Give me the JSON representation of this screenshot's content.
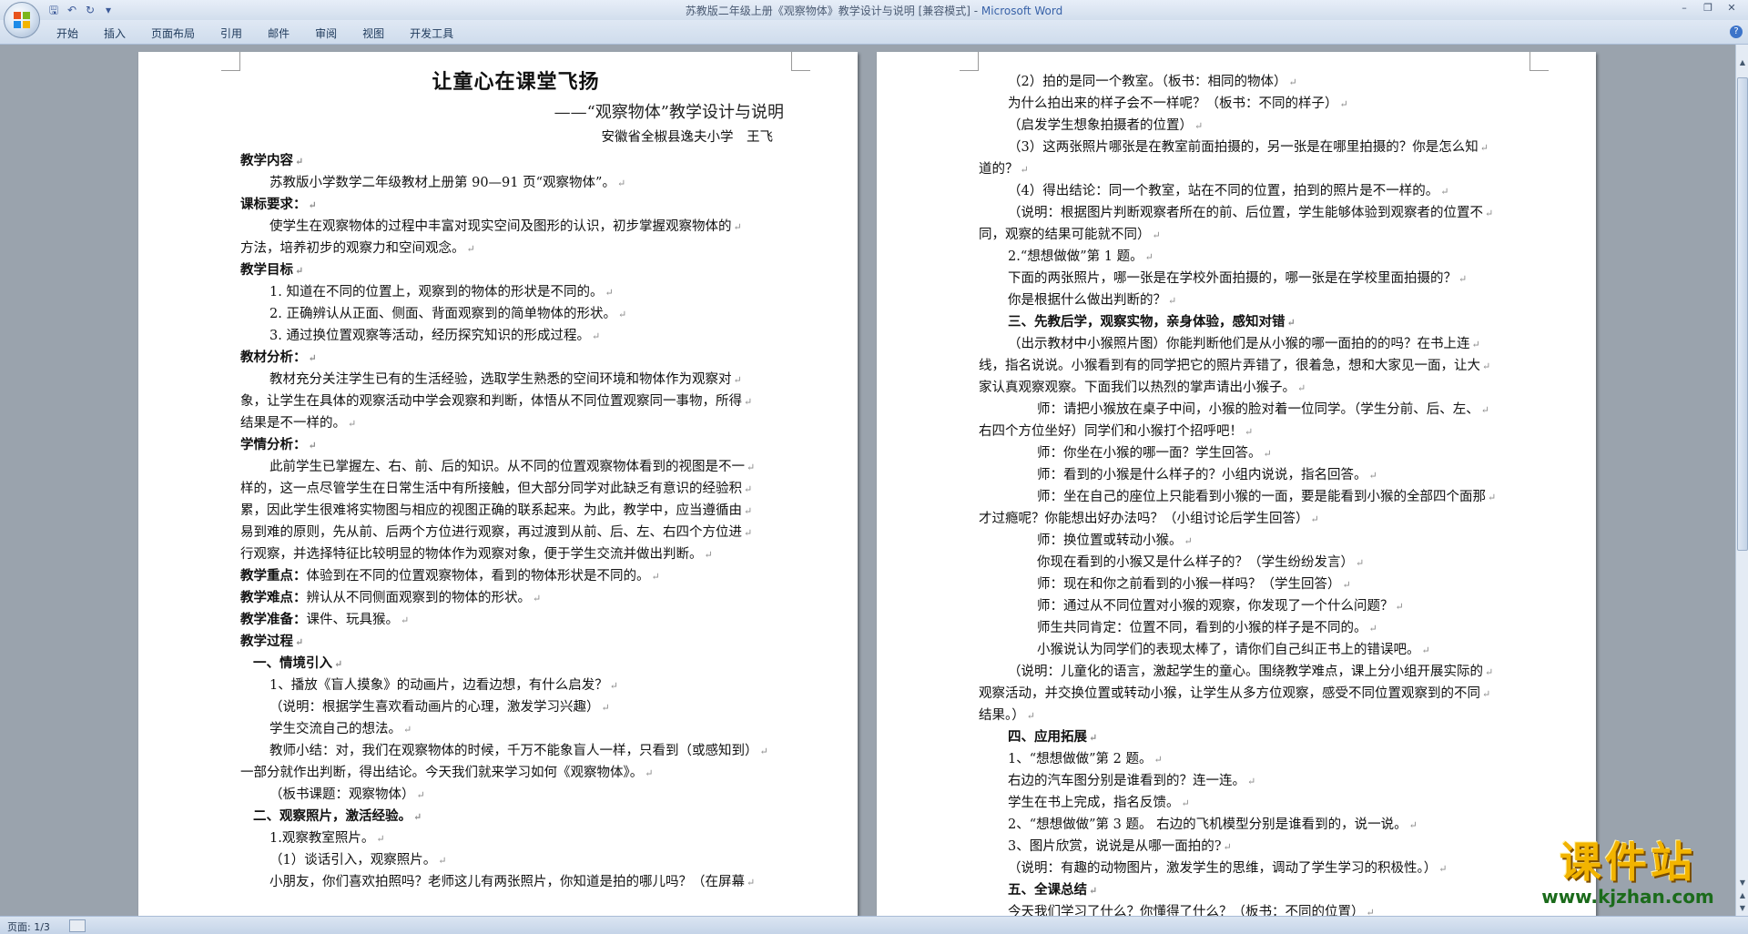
{
  "window": {
    "title": "苏教版二年级上册《观察物体》教学设计与说明 [兼容模式] - ",
    "app_name": "Microsoft Word"
  },
  "ribbon": {
    "tabs": [
      "开始",
      "插入",
      "页面布局",
      "引用",
      "邮件",
      "审阅",
      "视图",
      "开发工具"
    ]
  },
  "status": {
    "page": "页面: 1/3"
  },
  "watermark": {
    "title": "课件站",
    "url": "www.kjzhan.com"
  },
  "page_left": {
    "title": "让童心在课堂飞扬",
    "subtitle": "——“观察物体”教学设计与说明",
    "author": "安徽省全椒县逸夫小学　王飞",
    "lines": [
      {
        "t": "教学内容",
        "c": "b"
      },
      {
        "t": "苏教版小学数学二年级教材上册第 90—91 页“观察物体”。",
        "c": "i1"
      },
      {
        "t": "课标要求：",
        "c": "b"
      },
      {
        "t": "使学生在观察物体的过程中丰富对现实空间及图形的认识，初步掌握观察物体的",
        "c": "i1"
      },
      {
        "t": "方法，培养初步的观察力和空间观念。",
        "c": ""
      },
      {
        "t": "教学目标",
        "c": "b"
      },
      {
        "t": "1. 知道在不同的位置上，观察到的物体的形状是不同的。",
        "c": "i1"
      },
      {
        "t": "2. 正确辨认从正面、侧面、背面观察到的简单物体的形状。",
        "c": "i1"
      },
      {
        "t": "3. 通过换位置观察等活动，经历探究知识的形成过程。",
        "c": "i1"
      },
      {
        "t": "教材分析：",
        "c": "b"
      },
      {
        "t": "教材充分关注学生已有的生活经验，选取学生熟悉的空间环境和物体作为观察对",
        "c": "i1"
      },
      {
        "t": "象，让学生在具体的观察活动中学会观察和判断，体悟从不同位置观察同一事物，所得",
        "c": ""
      },
      {
        "t": "结果是不一样的。",
        "c": ""
      },
      {
        "t": "学情分析：",
        "c": "b"
      },
      {
        "t": "此前学生已掌握左、右、前、后的知识。从不同的位置观察物体看到的视图是不一",
        "c": "i1"
      },
      {
        "t": "样的，这一点尽管学生在日常生活中有所接触，但大部分同学对此缺乏有意识的经验积",
        "c": ""
      },
      {
        "t": "累，因此学生很难将实物图与相应的视图正确的联系起来。为此，教学中，应当遵循由",
        "c": ""
      },
      {
        "t": "易到难的原则，先从前、后两个方位进行观察，再过渡到从前、后、左、右四个方位进",
        "c": ""
      },
      {
        "t": "行观察，并选择特征比较明显的物体作为观察对象，便于学生交流并做出判断。",
        "c": ""
      },
      {
        "t": "教学重点：体验到在不同的位置观察物体，看到的物体形状是不同的。",
        "c": "bl"
      },
      {
        "t": "教学难点：辨认从不同侧面观察到的物体的形状。",
        "c": "bl"
      },
      {
        "t": "教学准备：课件、玩具猴。",
        "c": "bl"
      },
      {
        "t": "教学过程",
        "c": "b"
      },
      {
        "t": "一、情境引入",
        "c": "b i0"
      },
      {
        "t": "1、播放《盲人摸象》的动画片，边看边想，有什么启发？",
        "c": "i1"
      },
      {
        "t": "（说明：根据学生喜欢看动画片的心理，激发学习兴趣）",
        "c": "i1"
      },
      {
        "t": "学生交流自己的想法。",
        "c": "i1"
      },
      {
        "t": "教师小结：对，我们在观察物体的时候，千万不能象盲人一样，只看到（或感知到）",
        "c": "i1"
      },
      {
        "t": "一部分就作出判断，得出结论。今天我们就来学习如何《观察物体》。",
        "c": ""
      },
      {
        "t": "（板书课题：观察物体）",
        "c": "i1"
      },
      {
        "t": "二、观察照片，激活经验。",
        "c": "b i0"
      },
      {
        "t": "1.观察教室照片。",
        "c": "i1"
      },
      {
        "t": "（1）谈话引入，观察照片。",
        "c": "i1"
      },
      {
        "t": "小朋友，你们喜欢拍照吗？老师这儿有两张照片，你知道是拍的哪儿吗？（在屏幕",
        "c": "i1"
      }
    ]
  },
  "page_right": {
    "lines": [
      {
        "t": "（2）拍的是同一个教室。（板书：相同的物体）",
        "c": "i1"
      },
      {
        "t": "为什么拍出来的样子会不一样呢？（板书：不同的样子）",
        "c": "i1"
      },
      {
        "t": "（启发学生想象拍摄者的位置）",
        "c": "i1"
      },
      {
        "t": "（3）这两张照片哪张是在教室前面拍摄的，另一张是在哪里拍摄的？你是怎么知",
        "c": "i1"
      },
      {
        "t": "道的？",
        "c": ""
      },
      {
        "t": "（4）得出结论：同一个教室，站在不同的位置，拍到的照片是不一样的。",
        "c": "i1"
      },
      {
        "t": "（说明：根据图片判断观察者所在的前、后位置，学生能够体验到观察者的位置不",
        "c": "i1"
      },
      {
        "t": "同，观察的结果可能就不同）",
        "c": ""
      },
      {
        "t": "2.“想想做做”第 1 题。",
        "c": "i1"
      },
      {
        "t": "下面的两张照片，哪一张是在学校外面拍摄的，哪一张是在学校里面拍摄的？",
        "c": "i1"
      },
      {
        "t": "你是根据什么做出判断的？",
        "c": "i1"
      },
      {
        "t": "三、先教后学，观察实物，亲身体验，感知对错",
        "c": "b i1"
      },
      {
        "t": "（出示教材中小猴照片图）你能判断他们是从小猴的哪一面拍的的吗？在书上连",
        "c": "i1"
      },
      {
        "t": "线，指名说说。小猴看到有的同学把它的照片弄错了，很着急，想和大家见一面，让大",
        "c": ""
      },
      {
        "t": "家认真观察观察。下面我们以热烈的掌声请出小猴子。",
        "c": ""
      },
      {
        "t": "师：请把小猴放在桌子中间，小猴的脸对着一位同学。（学生分前、后、左、",
        "c": "i2"
      },
      {
        "t": "右四个方位坐好）同学们和小猴打个招呼吧！",
        "c": ""
      },
      {
        "t": "师：你坐在小猴的哪一面？学生回答。",
        "c": "i2"
      },
      {
        "t": "师：看到的小猴是什么样子的？小组内说说，指名回答。",
        "c": "i2"
      },
      {
        "t": "师：坐在自己的座位上只能看到小猴的一面，要是能看到小猴的全部四个面那",
        "c": "i2"
      },
      {
        "t": "才过瘾呢？你能想出好办法吗？（小组讨论后学生回答）",
        "c": ""
      },
      {
        "t": "师：换位置或转动小猴。",
        "c": "i2"
      },
      {
        "t": "你现在看到的小猴又是什么样子的？（学生纷纷发言）",
        "c": "i2"
      },
      {
        "t": "师：现在和你之前看到的小猴一样吗？（学生回答）",
        "c": "i2"
      },
      {
        "t": "师：通过从不同位置对小猴的观察，你发现了一个什么问题？",
        "c": "i2"
      },
      {
        "t": "师生共同肯定：位置不同，看到的小猴的样子是不同的。",
        "c": "i2"
      },
      {
        "t": "小猴说认为同学们的表现太棒了，请你们自己纠正书上的错误吧。",
        "c": "i2"
      },
      {
        "t": "（说明：儿童化的语言，激起学生的童心。围绕教学难点，课上分小组开展实际的",
        "c": "i1"
      },
      {
        "t": "观察活动，并交换位置或转动小猴，让学生从多方位观察，感受不同位置观察到的不同",
        "c": ""
      },
      {
        "t": "结果。）",
        "c": ""
      },
      {
        "t": "四、应用拓展",
        "c": "b i1"
      },
      {
        "t": "1、“想想做做”第 2 题。",
        "c": "i1"
      },
      {
        "t": "右边的汽车图分别是谁看到的？连一连。",
        "c": "i1"
      },
      {
        "t": "学生在书上完成，指名反馈。",
        "c": "i1"
      },
      {
        "t": "2、“想想做做”第 3 题。 右边的飞机模型分别是谁看到的，说一说。",
        "c": "i1"
      },
      {
        "t": "3、图片欣赏，说说是从哪一面拍的?",
        "c": "i1"
      },
      {
        "t": "（说明：有趣的动物图片，激发学生的思维，调动了学生学习的积极性。）",
        "c": "i1"
      },
      {
        "t": "五、全课总结",
        "c": "b i1"
      },
      {
        "t": "今天我们学习了什么？你懂得了什么？（板书：不同的位置）",
        "c": "i1"
      }
    ]
  }
}
